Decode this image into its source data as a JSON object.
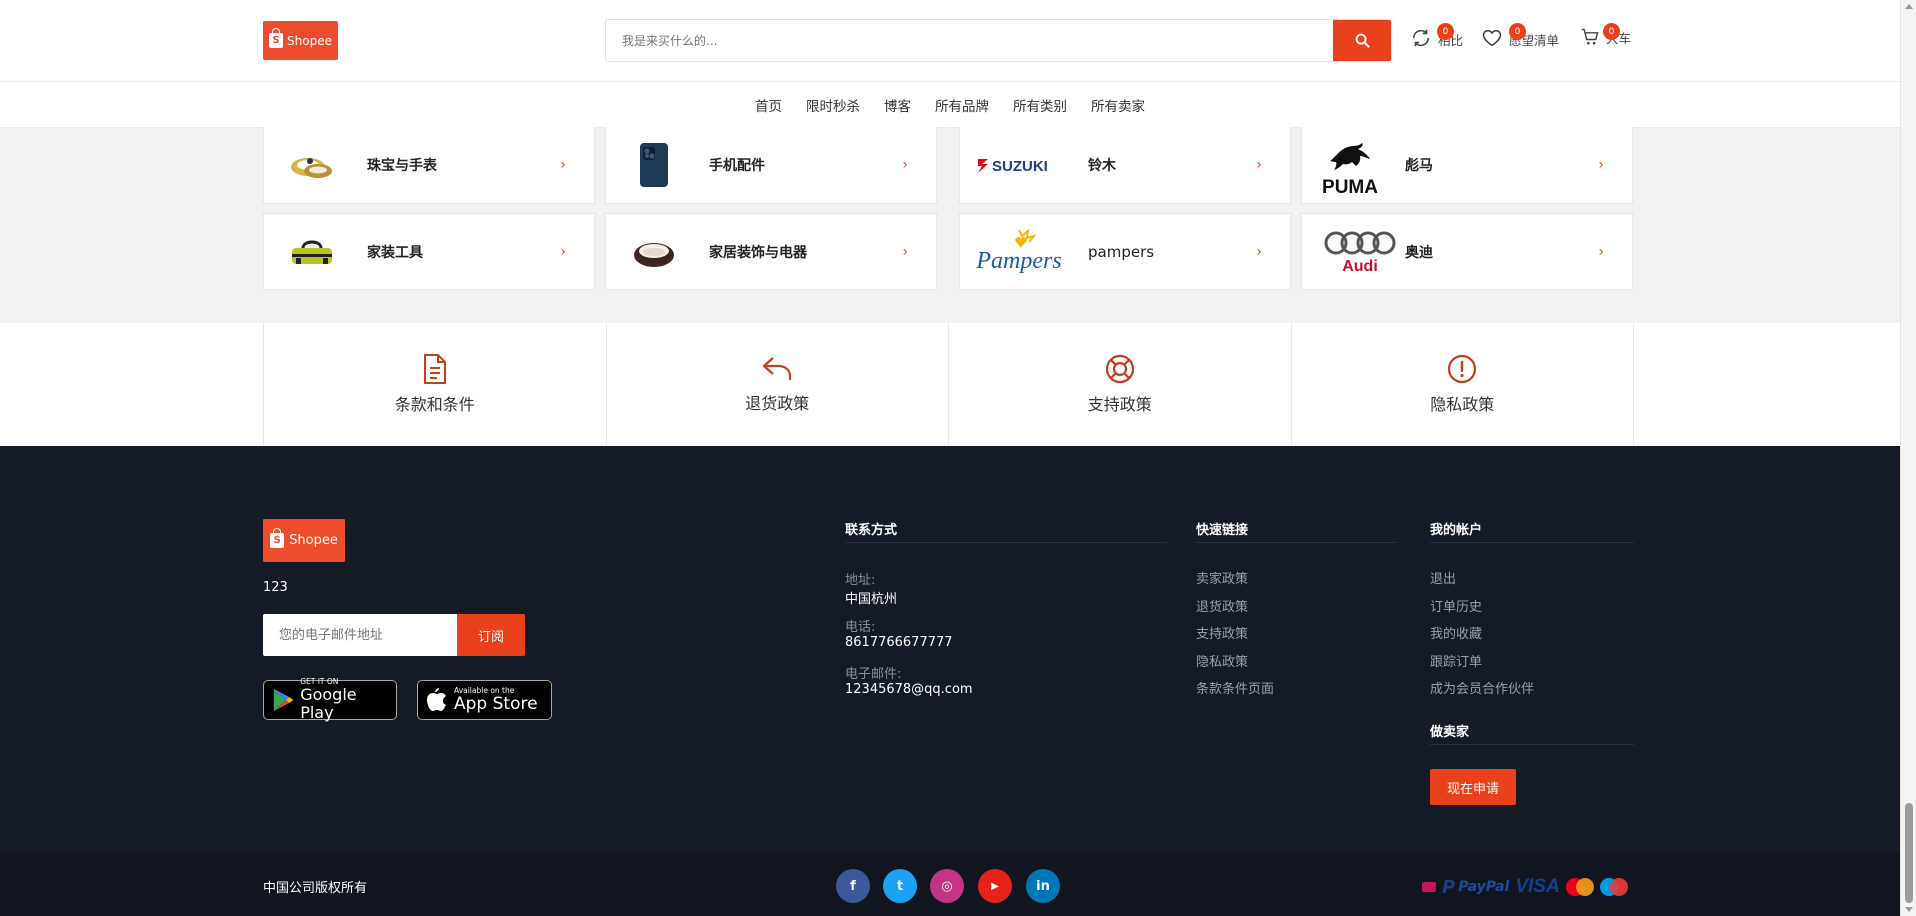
{
  "header": {
    "logo_text": "Shopee",
    "logo_bag_letter": "S",
    "search_placeholder": "我是来买什么的...",
    "compare": {
      "label": "相比",
      "count": "0"
    },
    "wishlist": {
      "label": "愿望清单",
      "count": "0"
    },
    "cart": {
      "label": "大车",
      "count": "0"
    }
  },
  "nav": {
    "items": [
      "首页",
      "限时秒杀",
      "博客",
      "所有品牌",
      "所有类别",
      "所有卖家"
    ]
  },
  "brands": [
    {
      "label": "珠宝与手表",
      "icon": "jewelry-watch-image"
    },
    {
      "label": "手机配件",
      "icon": "phone-image"
    },
    {
      "label": "铃木",
      "icon": "suzuki-logo",
      "logo_text": "SUZUKI"
    },
    {
      "label": "彪马",
      "icon": "puma-logo",
      "logo_text": "PUMA"
    },
    {
      "label": "家装工具",
      "icon": "tool-bag-image"
    },
    {
      "label": "家居装饰与电器",
      "icon": "pet-bed-image"
    },
    {
      "label": "pampers",
      "icon": "pampers-logo",
      "logo_text": "Pampers"
    },
    {
      "label": "奥迪",
      "icon": "audi-logo",
      "logo_text": "Audi"
    }
  ],
  "policies": [
    {
      "label": "条款和条件",
      "icon": "document-icon"
    },
    {
      "label": "退货政策",
      "icon": "return-arrow-icon"
    },
    {
      "label": "支持政策",
      "icon": "lifebuoy-icon"
    },
    {
      "label": "隐私政策",
      "icon": "alert-circle-icon"
    }
  ],
  "footer": {
    "logo_text": "Shopee",
    "about": "123",
    "subscribe_placeholder": "您的电子邮件地址",
    "subscribe_button": "订阅",
    "google_play": {
      "small": "GET IT ON",
      "big": "Google Play"
    },
    "app_store": {
      "small": "Available on the",
      "big": "App Store"
    },
    "contact": {
      "title": "联系方式",
      "address_label": "地址:",
      "address": "中国杭州",
      "phone_label": "电话:",
      "phone": "8617766677777",
      "email_label": "电子邮件:",
      "email": "12345678@qq.com"
    },
    "quick_links": {
      "title": "快速链接",
      "items": [
        "卖家政策",
        "退货政策",
        "支持政策",
        "隐私政策",
        "条款条件页面"
      ]
    },
    "account": {
      "title": "我的帐户",
      "items": [
        "退出",
        "订单历史",
        "我的收藏",
        "跟踪订单",
        "成为会员合作伙伴"
      ]
    },
    "seller": {
      "title": "做卖家",
      "button": "现在申请"
    },
    "copyright": "中国公司版权所有",
    "social": [
      {
        "name": "facebook",
        "glyph": "f",
        "color": "#3b5998"
      },
      {
        "name": "twitter",
        "glyph": "t",
        "color": "#1da1f2"
      },
      {
        "name": "instagram",
        "glyph": "◎",
        "color": "#c13584"
      },
      {
        "name": "youtube",
        "glyph": "▶",
        "color": "#e62117"
      },
      {
        "name": "linkedin",
        "glyph": "in",
        "color": "#0077b5"
      }
    ],
    "payments": {
      "paypal": "PayPal",
      "visa": "VISA"
    }
  },
  "colors": {
    "accent": "#e8411c",
    "brand": "#ee4d2d",
    "footer_bg": "#141a26"
  }
}
